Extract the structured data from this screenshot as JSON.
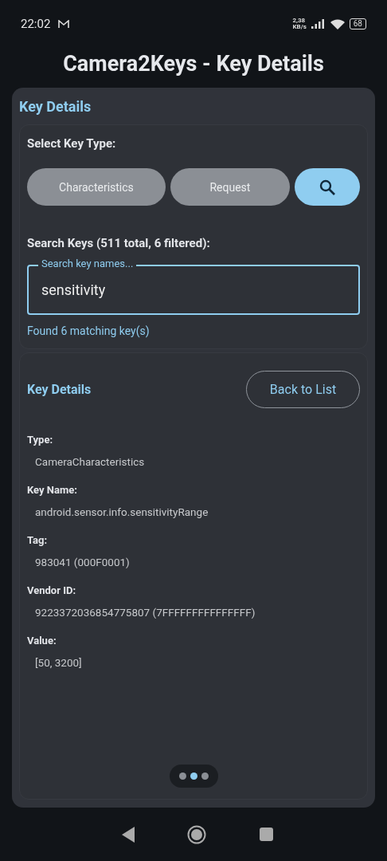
{
  "status_bar": {
    "time": "22:02",
    "speed_value": "2,38",
    "speed_unit": "KB/s",
    "battery": "68"
  },
  "title": "Camera2Keys - Key Details",
  "panel": {
    "heading": "Key Details",
    "key_type": {
      "label": "Select Key Type:",
      "buttons": [
        {
          "kind": "text",
          "label": "Characteristics",
          "selected": false
        },
        {
          "kind": "text",
          "label": "Request",
          "selected": false
        },
        {
          "kind": "search",
          "selected": true
        }
      ]
    },
    "search": {
      "label": "Search Keys (511 total, 6 filtered):",
      "placeholder": "Search key names...",
      "value": "sensitivity",
      "result": "Found 6 matching key(s)"
    },
    "details": {
      "heading": "Key Details",
      "back_button": "Back to List",
      "fields": [
        {
          "label": "Type:",
          "value": "CameraCharacteristics"
        },
        {
          "label": "Key Name:",
          "value": "android.sensor.info.sensitivityRange"
        },
        {
          "label": "Tag:",
          "value": "983041 (000F0001)"
        },
        {
          "label": "Vendor ID:",
          "value": "9223372036854775807 (7FFFFFFFFFFFFFFF)"
        },
        {
          "label": "Value:",
          "value": "[50, 3200]"
        }
      ]
    },
    "page_dots": [
      {
        "selected": false
      },
      {
        "selected": true
      },
      {
        "selected": false
      }
    ]
  }
}
